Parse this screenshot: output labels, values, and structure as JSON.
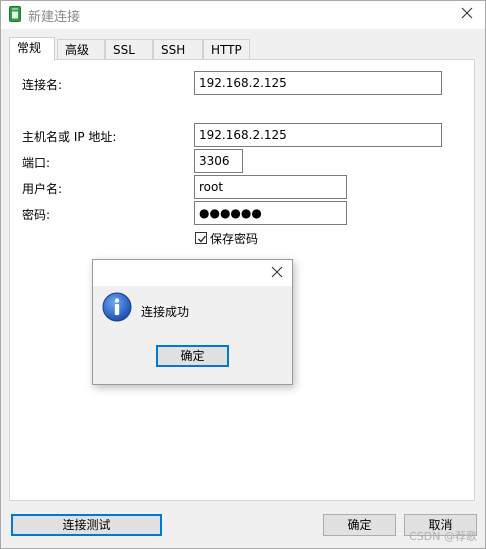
{
  "window": {
    "title": "新建连接",
    "close_icon": "close-icon"
  },
  "tabs": [
    {
      "label": "常规",
      "active": true
    },
    {
      "label": "高级",
      "active": false
    },
    {
      "label": "SSL",
      "active": false
    },
    {
      "label": "SSH",
      "active": false
    },
    {
      "label": "HTTP",
      "active": false
    }
  ],
  "form": {
    "connection_name_label": "连接名:",
    "connection_name_value": "192.168.2.125",
    "host_label": "主机名或 IP 地址:",
    "host_value": "192.168.2.125",
    "port_label": "端口:",
    "port_value": "3306",
    "username_label": "用户名:",
    "username_value": "root",
    "password_label": "密码:",
    "password_value": "●●●●●●",
    "save_password_label": "保存密码",
    "save_password_checked": true
  },
  "dialog": {
    "message": "连接成功",
    "ok_label": "确定",
    "icon": "info-icon"
  },
  "footer": {
    "test_label": "连接测试",
    "ok_label": "确定",
    "cancel_label": "取消"
  },
  "watermark": "CSDN @荐歌",
  "colors": {
    "accent": "#0078d7",
    "title_text": "#8a8a8a",
    "dialog_bg": "#f0f0f0"
  }
}
